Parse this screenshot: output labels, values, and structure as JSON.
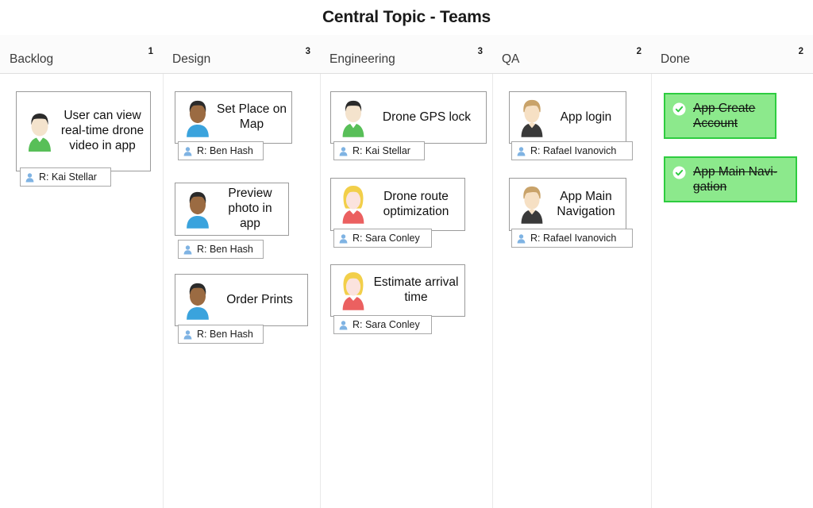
{
  "board": {
    "title": "Central Topic - Teams",
    "accent_green_fill": "#8ce98c",
    "accent_green_border": "#2ecc40",
    "card_border": "#9a9a9a",
    "divider": "#e9e9e9"
  },
  "columns": [
    {
      "name": "Backlog",
      "count": "1"
    },
    {
      "name": "Design",
      "count": "3"
    },
    {
      "name": "Engineering",
      "count": "3"
    },
    {
      "name": "QA",
      "count": "2"
    },
    {
      "name": "Done",
      "count": "2"
    }
  ],
  "cards": [
    {
      "column": "Backlog",
      "title": "User can view real-time drone video in app",
      "assignee": "R: Kai Stellar",
      "avatar": "avatar-kai-stellar",
      "status": "open"
    },
    {
      "column": "Design",
      "title": "Set Place on Map",
      "assignee": "R: Ben Hash",
      "avatar": "avatar-ben-hash",
      "status": "open"
    },
    {
      "column": "Design",
      "title": "Preview photo in app",
      "assignee": "R: Ben Hash",
      "avatar": "avatar-ben-hash",
      "status": "open"
    },
    {
      "column": "Design",
      "title": "Order Prints",
      "assignee": "R: Ben Hash",
      "avatar": "avatar-ben-hash",
      "status": "open"
    },
    {
      "column": "Engineering",
      "title": "Drone GPS lock",
      "assignee": "R: Kai Stellar",
      "avatar": "avatar-kai-stellar",
      "status": "open"
    },
    {
      "column": "Engineering",
      "title": "Drone route optimization",
      "assignee": "R: Sara Conley",
      "avatar": "avatar-sara-conley",
      "status": "open"
    },
    {
      "column": "Engineering",
      "title": "Estimate arrival time",
      "assignee": "R: Sara Conley",
      "avatar": "avatar-sara-conley",
      "status": "open"
    },
    {
      "column": "QA",
      "title": "App login",
      "assignee": "R: Rafael Ivanovich",
      "avatar": "avatar-rafael-ivanovich",
      "status": "open"
    },
    {
      "column": "QA",
      "title": "App Main Navigation",
      "assignee": "R: Rafael Ivanovich",
      "avatar": "avatar-rafael-ivanovich",
      "status": "open"
    },
    {
      "column": "Done",
      "title": "App Create Account",
      "assignee": null,
      "avatar": null,
      "status": "done"
    },
    {
      "column": "Done",
      "title": "App Main Navi-gation",
      "assignee": null,
      "avatar": null,
      "status": "done"
    }
  ]
}
